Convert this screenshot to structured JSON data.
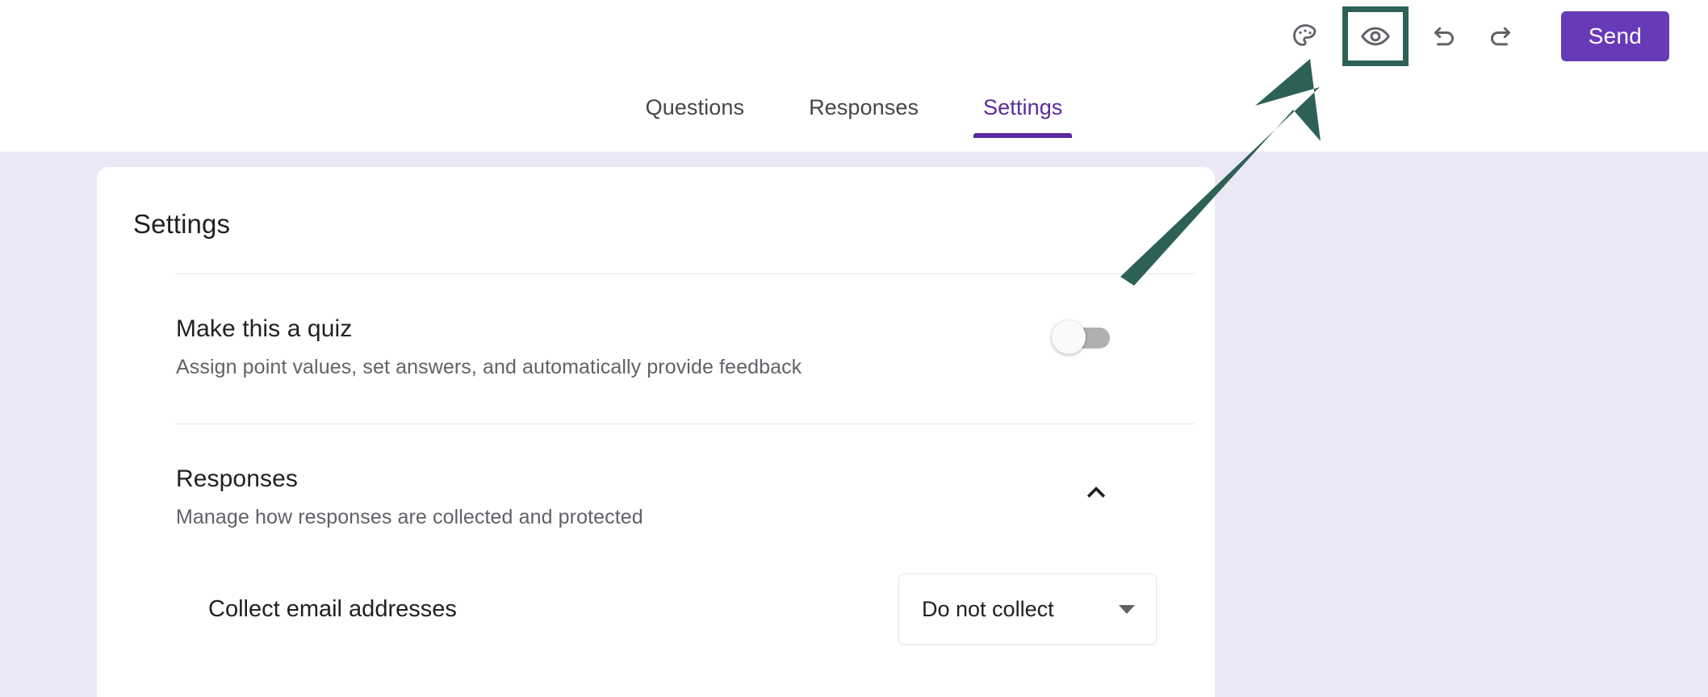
{
  "toolbar": {
    "theme_label": "Theme",
    "theme_icon": "palette-icon",
    "preview_label": "Preview",
    "preview_icon": "eye-icon",
    "undo_label": "Undo",
    "undo_icon": "undo-icon",
    "redo_label": "Redo",
    "redo_icon": "redo-icon",
    "send_label": "Send",
    "send_color": "#673ab7"
  },
  "tabs": [
    {
      "label": "Questions",
      "active": false
    },
    {
      "label": "Responses",
      "active": false
    },
    {
      "label": "Settings",
      "active": true
    }
  ],
  "card": {
    "title": "Settings",
    "quiz": {
      "title": "Make this a quiz",
      "subtitle": "Assign point values, set answers, and automatically provide feedback",
      "toggle_state": "off"
    },
    "responses": {
      "title": "Responses",
      "subtitle": "Manage how responses are collected and protected",
      "collapse_icon": "chevron-up-icon",
      "expanded": true,
      "collect_email": {
        "label": "Collect email addresses",
        "value": "Do not collect",
        "caret_icon": "caret-down-icon"
      }
    }
  },
  "annotation": {
    "arrow_color": "#2d6158",
    "highlight_color": "#2d6158",
    "target": "preview-button"
  },
  "colors": {
    "page_background": "#ebe8f5",
    "card_background": "#ffffff",
    "accent_purple": "#5b2a9e",
    "text_primary": "#202124",
    "text_secondary": "#5f6368"
  }
}
